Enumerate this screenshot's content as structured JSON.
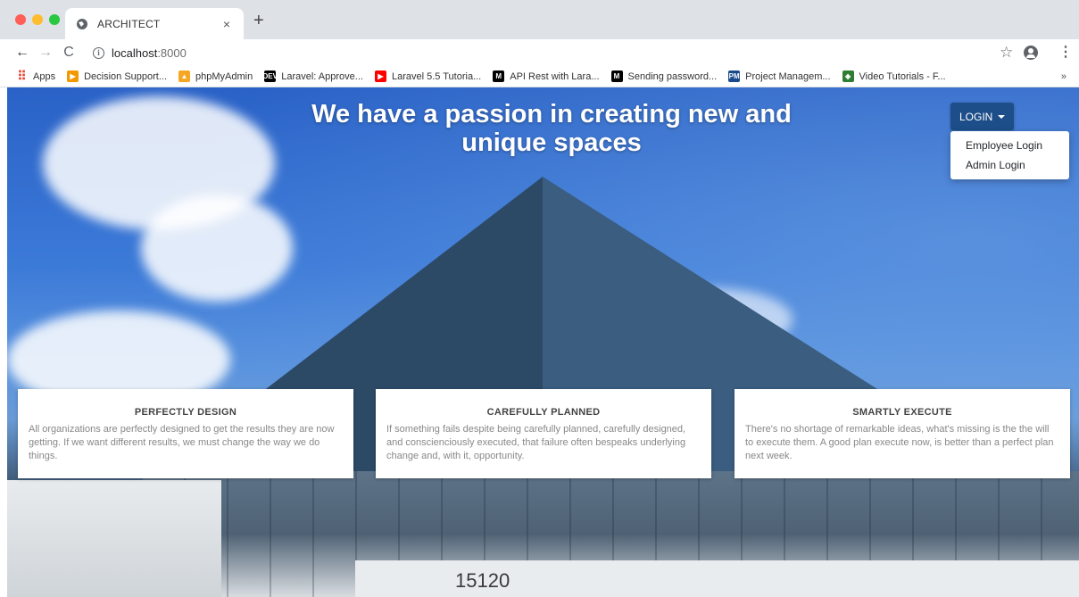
{
  "browser": {
    "tab_title": "ARCHITECT",
    "tab_close": "×",
    "new_tab": "+",
    "url_host": "localhost",
    "url_port": ":8000",
    "back": "←",
    "forward": "→",
    "reload": "C",
    "star": "☆",
    "menu": "⋮",
    "bookmarks": [
      {
        "label": "Apps",
        "icon": "apps-grid-icon",
        "icon_text": "⠿",
        "color": "#ea4335"
      },
      {
        "label": "Decision Support...",
        "icon": "decision-support-icon",
        "icon_text": "▶",
        "color": "#f29900"
      },
      {
        "label": "phpMyAdmin",
        "icon": "phpmyadmin-icon",
        "icon_text": "▲",
        "color": "#f5a623"
      },
      {
        "label": "Laravel: Approve...",
        "icon": "dev-icon",
        "icon_text": "DEV",
        "color": "#000000"
      },
      {
        "label": "Laravel 5.5 Tutoria...",
        "icon": "youtube-icon",
        "icon_text": "▶",
        "color": "#ff0000"
      },
      {
        "label": "API Rest with Lara...",
        "icon": "medium-icon",
        "icon_text": "M",
        "color": "#000000"
      },
      {
        "label": "Sending password...",
        "icon": "medium-icon",
        "icon_text": "M",
        "color": "#000000"
      },
      {
        "label": "Project Managem...",
        "icon": "pm-icon",
        "icon_text": "PM",
        "color": "#1a4a8a"
      },
      {
        "label": "Video Tutorials - F...",
        "icon": "diamond-icon",
        "icon_text": "◈",
        "color": "#2e7d32"
      }
    ],
    "bookmarks_more": "»"
  },
  "page": {
    "hero_title": "We have a passion in creating new and unique spaces",
    "login": {
      "label": "LOGIN",
      "menu": [
        "Employee Login",
        "Admin Login"
      ]
    },
    "building_number": "15120",
    "cards": [
      {
        "title": "PERFECTLY DESIGN",
        "text": "All organizations are perfectly designed to get the results they are now getting. If we want different results, we must change the way we do things."
      },
      {
        "title": "CAREFULLY PLANNED",
        "text": "If something fails despite being carefully planned, carefully designed, and conscienciously executed, that failure often bespeaks underlying change and, with it, opportunity."
      },
      {
        "title": "SMARTLY EXECUTE",
        "text": "There's no shortage of remarkable ideas, what's missing is the the will to execute them. A good plan execute now, is better than a perfect plan next week."
      }
    ]
  },
  "colors": {
    "login_button": "#1d4e89",
    "tab_bar": "#dee1e6"
  }
}
